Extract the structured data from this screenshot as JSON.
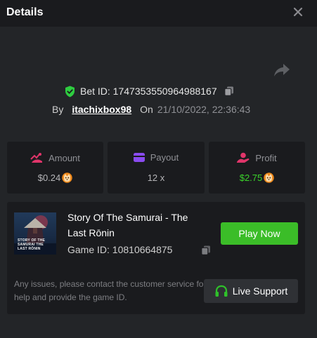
{
  "header": {
    "title": "Details",
    "close_icon": "close-icon"
  },
  "share_icon": "share-icon",
  "bet": {
    "id_label": "Bet ID: 1747353550964988167",
    "by_label": "By",
    "username": "itachixbox98",
    "on_label": "On",
    "datetime": "21/10/2022, 22:36:43",
    "verified_icon": "shield-check-icon",
    "copy_icon": "copy-icon"
  },
  "stats": {
    "amount": {
      "label": "Amount",
      "value": "$0.24",
      "icon": "amount-icon",
      "coin_icon": "shib-coin-icon"
    },
    "payout": {
      "label": "Payout",
      "value": "12 x",
      "icon": "wallet-icon"
    },
    "profit": {
      "label": "Profit",
      "value": "$2.75",
      "icon": "profit-icon",
      "coin_icon": "shib-coin-icon"
    }
  },
  "game": {
    "name": "Story Of The Samurai - The Last Rōnin",
    "thumbnail_text": "STORY OF THE SAMURAI THE LAST RŌNIN",
    "id_label": "Game ID: 10810664875",
    "play_label": "Play Now",
    "support_note": "Any issues, please contact the customer service for help and provide the game ID.",
    "support_label": "Live Support",
    "support_icon": "headset-icon"
  },
  "colors": {
    "background": "#232528",
    "panel": "#1a1b1e",
    "accent_green": "#3bbd28",
    "profit_green": "#3bd42b",
    "amount_icon": "#e0356a",
    "payout_icon": "#8a4bf0",
    "profit_icon": "#e0356a"
  }
}
